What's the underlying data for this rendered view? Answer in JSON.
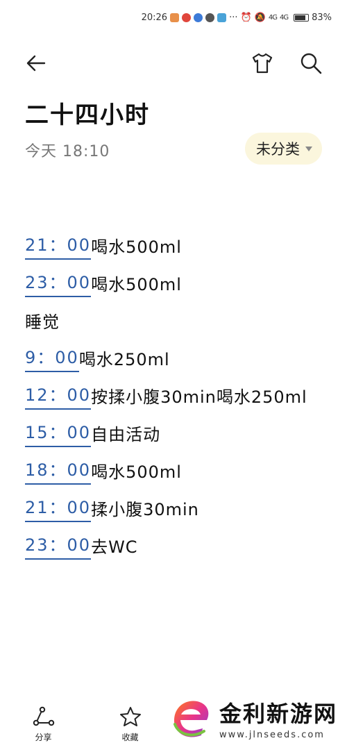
{
  "statusbar": {
    "time": "20:26",
    "more": "···",
    "signal1": "4G",
    "signal2": "4G",
    "battery": "83%",
    "battery_level": 0.83
  },
  "note": {
    "title": "二十四小时",
    "date": "今天 18:10",
    "category": "未分类",
    "lines": [
      {
        "time": "21：00",
        "text": "喝水500ml"
      },
      {
        "time": "23：00",
        "text": "喝水500ml"
      },
      {
        "time": "",
        "text": "睡觉"
      },
      {
        "time": "9：00",
        "text": "喝水250ml"
      },
      {
        "time": "12：00",
        "text": "按揉小腹30min喝水250ml"
      },
      {
        "time": "15：00",
        "text": "自由活动"
      },
      {
        "time": "18：00",
        "text": "喝水500ml"
      },
      {
        "time": "21：00",
        "text": "揉小腹30min"
      },
      {
        "time": "23：00",
        "text": "去WC"
      }
    ]
  },
  "toolbar": {
    "share_label": "分享",
    "favorite_label": "收藏"
  },
  "watermark": {
    "title": "金利新游网",
    "url": "www.jlnseeds.com"
  },
  "colors": {
    "time_link": "#2d5da6",
    "chip_bg": "#fbf6dd"
  }
}
